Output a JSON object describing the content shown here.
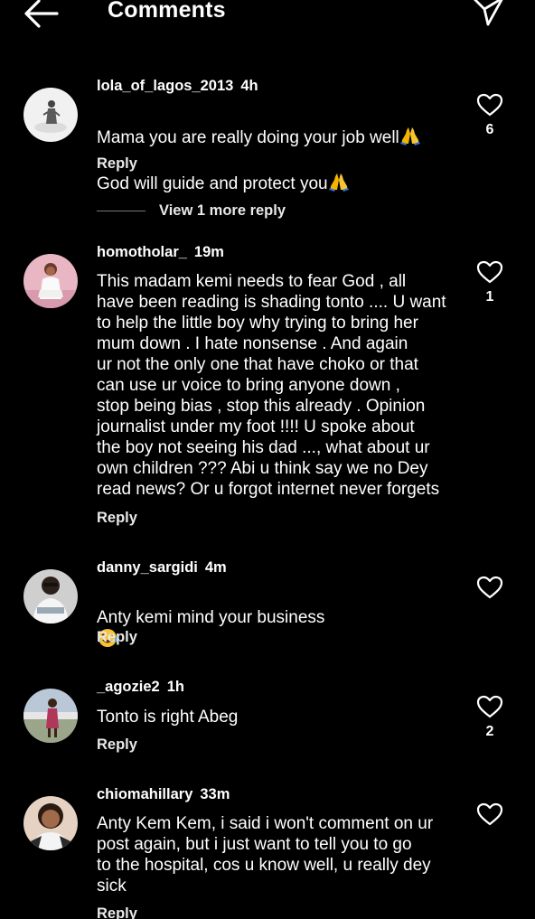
{
  "header": {
    "title": "Comments",
    "back_icon": "arrow-left-icon",
    "send_icon": "paper-plane-icon"
  },
  "comments": [
    {
      "username": "lola_of_lagos_2013",
      "time": "4h",
      "text": "Mama you are really doing your job well",
      "text2": "God will guide and protect you",
      "reply_label": "Reply",
      "likes": "6",
      "view_more": "View 1 more reply"
    },
    {
      "username": "homotholar_",
      "time": "19m",
      "text": "This madam kemi needs to fear God , all\nhave been reading is shading tonto .... U want\nto help the little boy why trying to bring her\nmum down . I hate nonsense . And again\nur not the only one that have choko or that\ncan use ur voice to bring anyone down ,\nstop being bias , stop this already . Opinion\njournalist under my foot !!!! U spoke about\nthe boy not seeing his dad ..., what about ur\nown children ??? Abi u think say we no Dey\nread news? Or u forgot internet never forgets",
      "reply_label": "Reply",
      "likes": "1"
    },
    {
      "username": "danny_sargidi",
      "time": "4m",
      "text": "Anty kemi mind your business",
      "reply_label": "Reply",
      "likes": ""
    },
    {
      "username": "_agozie2",
      "time": "1h",
      "text": "Tonto is right Abeg",
      "reply_label": "Reply",
      "likes": "2"
    },
    {
      "username": "chiomahillary",
      "time": "33m",
      "text": "Anty Kem Kem, i said i won't comment on ur\npost again, but i just want to tell you to go\nto the hospital, cos u know well, u really dey\nsick",
      "reply_label": "Reply",
      "likes": ""
    }
  ],
  "icons": {
    "like": "heart-outline-icon",
    "pray": "folded-hands-emoji",
    "laugh": "tears-of-joy-emoji"
  }
}
